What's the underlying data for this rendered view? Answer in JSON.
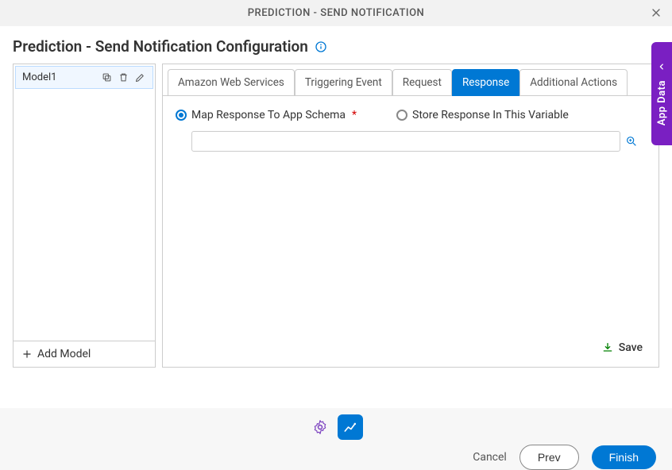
{
  "titleBar": {
    "text": "PREDICTION - SEND NOTIFICATION"
  },
  "pageTitle": "Prediction - Send Notification Configuration",
  "modelPanel": {
    "items": [
      {
        "label": "Model1"
      }
    ],
    "addLabel": "Add Model"
  },
  "tabs": [
    {
      "label": "Amazon Web Services",
      "active": false
    },
    {
      "label": "Triggering Event",
      "active": false
    },
    {
      "label": "Request",
      "active": false
    },
    {
      "label": "Response",
      "active": true
    },
    {
      "label": "Additional Actions",
      "active": false
    }
  ],
  "responseTab": {
    "option1": "Map Response To App Schema",
    "option2": "Store Response In This Variable",
    "inputValue": "",
    "saveLabel": "Save"
  },
  "buttons": {
    "cancel": "Cancel",
    "prev": "Prev",
    "finish": "Finish"
  },
  "sideDrawer": {
    "label": "App Data"
  }
}
